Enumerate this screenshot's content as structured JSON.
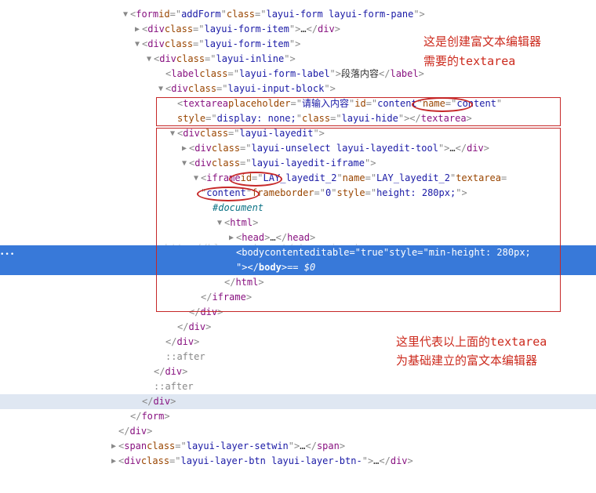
{
  "lines": {
    "form": {
      "tag": "form",
      "id_attr": "id",
      "id_val": "addForm",
      "class_attr": "class",
      "class_val": "layui-form layui-form-pane"
    },
    "div1": {
      "tag": "div",
      "class_attr": "class",
      "class_val": "layui-form-item",
      "ell": "…"
    },
    "div2": {
      "tag": "div",
      "class_attr": "class",
      "class_val": "layui-form-item"
    },
    "div3": {
      "tag": "div",
      "class_attr": "class",
      "class_val": "layui-inline"
    },
    "label": {
      "tag": "label",
      "class_attr": "class",
      "class_val": "layui-form-label",
      "text": "段落内容"
    },
    "div4": {
      "tag": "div",
      "class_attr": "class",
      "class_val": "layui-input-block"
    },
    "ta": {
      "tag": "textarea",
      "ph_attr": "placeholder",
      "ph_val": "请输入内容",
      "id_attr": "id",
      "id_val": "content",
      "name_attr": "name",
      "name_val": "content",
      "style_attr": "style",
      "style_val": "display: none;",
      "class_attr": "class",
      "class_val": "layui-hide"
    },
    "div5": {
      "tag": "div",
      "class_attr": "class",
      "class_val": "layui-layedit"
    },
    "div6": {
      "tag": "div",
      "class_attr": "class",
      "class_val": "layui-unselect layui-layedit-tool",
      "ell": "…"
    },
    "div7": {
      "tag": "div",
      "class_attr": "class",
      "class_val": "layui-layedit-iframe"
    },
    "iframe": {
      "tag": "iframe",
      "id_attr": "id",
      "id_val": "LAY_layedit_2",
      "name_attr": "name",
      "name_val": "LAY_layedit_2",
      "ta_attr": "textarea",
      "ta_val": "content",
      "fb_attr": "frameborder",
      "fb_val": "0",
      "style_attr": "style",
      "style_val": "height: 280px;"
    },
    "doc": "#document",
    "html": {
      "tag": "html"
    },
    "head": {
      "tag": "head",
      "ell": "…"
    },
    "body": {
      "tag": "body",
      "ce_attr": "contenteditable",
      "ce_val": "true",
      "style_attr": "style",
      "style_val": "min-height: 280px;",
      "suf": " == $0"
    },
    "after": "::after",
    "span": {
      "tag": "span",
      "class_attr": "class",
      "class_val": "layui-layer-setwin",
      "ell": "…"
    },
    "divbtn": {
      "tag": "div",
      "class_attr": "class",
      "class_val": "layui-layer-btn layui-layer-btn-",
      "ell": "…"
    },
    "close": {
      "div": "div",
      "form": "form",
      "iframe": "iframe",
      "html": "html",
      "body": "body",
      "span": "span",
      "textarea": "textarea"
    }
  },
  "annotations": {
    "a1_l1": "这是创建富文本编辑器",
    "a1_l2": "需要的",
    "a1_l2b": "textarea",
    "a2_l1": "这里代表以上面的",
    "a2_l1b": "textarea",
    "a2_l2": "为基础建立的富文本编辑器"
  },
  "watermark": "http://blog.csdn.net/zhengxiangbao",
  "gutter": "•••"
}
